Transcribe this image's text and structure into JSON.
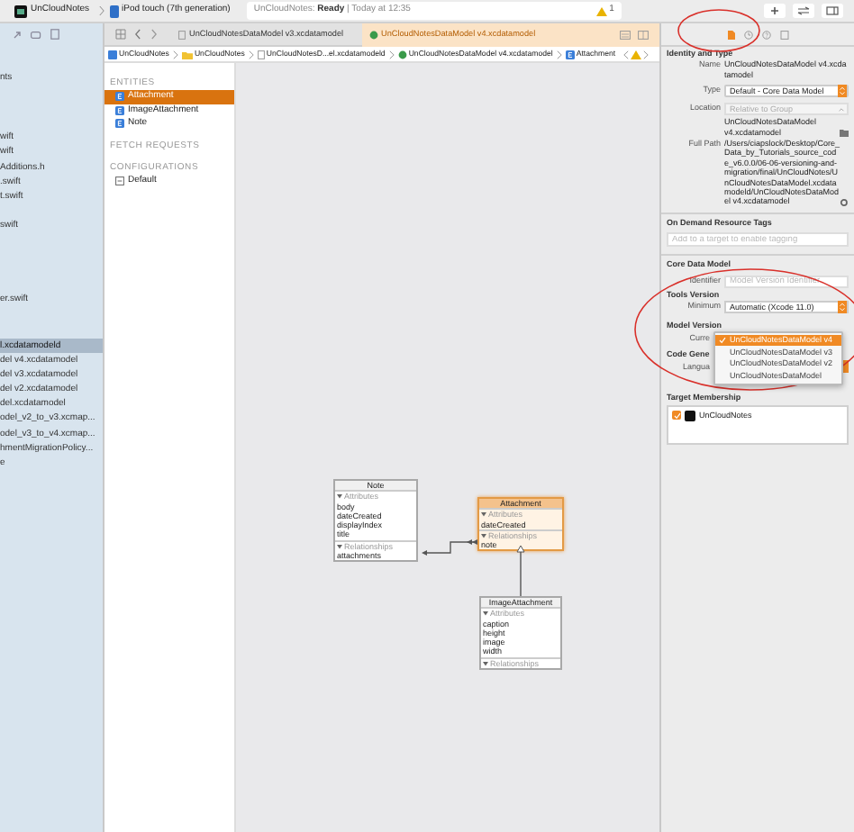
{
  "toolbar": {
    "scheme": "UnCloudNotes",
    "device": "iPod touch (7th generation)",
    "status_app": "UnCloudNotes:",
    "status_state": "Ready",
    "status_time": "| Today at 12:35",
    "warnings": "1"
  },
  "navigator": {
    "items": [
      {
        "label": "nts",
        "selected": false
      },
      {
        "label": "wift",
        "selected": false
      },
      {
        "label": "wift",
        "selected": false
      },
      {
        "label": "Additions.h",
        "selected": false
      },
      {
        "label": ".swift",
        "selected": false
      },
      {
        "label": "t.swift",
        "selected": false
      },
      {
        "label": "swift",
        "selected": false
      },
      {
        "label": "er.swift",
        "selected": false
      },
      {
        "label": "l.xcdatamodeld",
        "selected": true
      },
      {
        "label": "del v4.xcdatamodel",
        "selected": false
      },
      {
        "label": "del v3.xcdatamodel",
        "selected": false
      },
      {
        "label": "del v2.xcdatamodel",
        "selected": false
      },
      {
        "label": "del.xcdatamodel",
        "selected": false
      },
      {
        "label": "odel_v2_to_v3.xcmap...",
        "selected": false
      },
      {
        "label": "odel_v3_to_v4.xcmap...",
        "selected": false
      },
      {
        "label": "hmentMigrationPolicy...",
        "selected": false
      },
      {
        "label": "e",
        "selected": false
      }
    ]
  },
  "tabs": [
    {
      "label": "UnCloudNotesDataModel v3.xcdatamodel",
      "selected": false
    },
    {
      "label": "UnCloudNotesDataModel v4.xcdatamodel",
      "selected": true
    }
  ],
  "jump_bar": [
    {
      "kind": "project",
      "label": "UnCloudNotes"
    },
    {
      "kind": "folder",
      "label": "UnCloudNotes"
    },
    {
      "kind": "file",
      "label": "UnCloudNotesD...el.xcdatamodeld"
    },
    {
      "kind": "model",
      "label": "UnCloudNotesDataModel v4.xcdatamodel"
    },
    {
      "kind": "entity",
      "label": "Attachment"
    }
  ],
  "outline": [
    {
      "title": "ENTITIES",
      "items": [
        {
          "kind": "entity",
          "label": "Attachment",
          "selected": true
        },
        {
          "kind": "entity",
          "label": "ImageAttachment",
          "selected": false
        },
        {
          "kind": "entity",
          "label": "Note",
          "selected": false
        }
      ]
    },
    {
      "title": "FETCH REQUESTS"
    },
    {
      "title": "CONFIGURATIONS",
      "items": [
        {
          "kind": "configuration",
          "label": "Default",
          "selected": false
        }
      ]
    }
  ],
  "diagram": {
    "entities": [
      {
        "name": "Note",
        "selected": false,
        "attributes_label": "Attributes",
        "attributes": [
          "body",
          "dateCreated",
          "displayIndex",
          "title"
        ],
        "relationships_label": "Relationships",
        "relationships": [
          "attachments"
        ]
      },
      {
        "name": "Attachment",
        "selected": true,
        "attributes_label": "Attributes",
        "attributes": [
          "dateCreated"
        ],
        "relationships_label": "Relationships",
        "relationships": [
          "note"
        ]
      },
      {
        "name": "ImageAttachment",
        "selected": false,
        "attributes_label": "Attributes",
        "attributes": [
          "caption",
          "height",
          "image",
          "width"
        ],
        "relationships_label": "Relationships"
      }
    ]
  },
  "inspector": {
    "identity": {
      "title": "Identity and Type",
      "name_label": "Name",
      "name": "UnCloudNotesDataModel v4.xcdatamodel",
      "type_label": "Type",
      "type": "Default - Core Data Model",
      "location_label": "Location",
      "location": "Relative to Group",
      "location_path": "UnCloudNotesDataModel v4.xcdatamodel",
      "full_path_label": "Full Path",
      "full_path": "/Users/ciapslock/Desktop/Core_Data_by_Tutorials_source_code_v6.0.0/06-06-versioning-and-migration/final/UnCloudNotes/UnCloudNotesDataModel.xcdatamodeld/UnCloudNotesDataModel v4.xcdatamodel"
    },
    "tags": {
      "title": "On Demand Resource Tags",
      "placeholder": "Add to a target to enable tagging"
    },
    "core_data": {
      "title": "Core Data Model",
      "identifier_label": "Identifier",
      "identifier_placeholder": "Model Version Identifier"
    },
    "tools": {
      "title": "Tools Version",
      "minimum_label": "Minimum",
      "minimum": "Automatic (Xcode 11.0)"
    },
    "model_version": {
      "title": "Model Version",
      "current_label": "Curre",
      "options": [
        {
          "label": "UnCloudNotesDataModel v4",
          "selected": true
        },
        {
          "label": "UnCloudNotesDataModel v3",
          "selected": false
        },
        {
          "label": "UnCloudNotesDataModel v2",
          "selected": false
        },
        {
          "label": "UnCloudNotesDataModel",
          "selected": false
        }
      ]
    },
    "codegen": {
      "title": "Code Gene",
      "language_label": "Langua"
    },
    "membership": {
      "title": "Target Membership",
      "targets": [
        {
          "label": "UnCloudNotes",
          "checked": true
        }
      ]
    }
  }
}
